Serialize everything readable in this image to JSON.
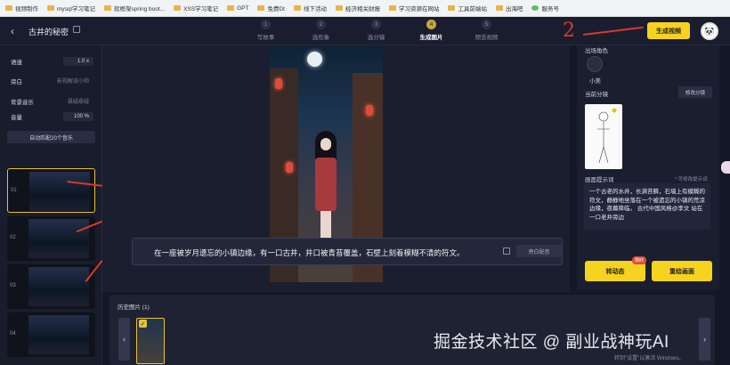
{
  "bookmarks": [
    "视频制作",
    "mysql学习笔记",
    "就框架spring boot...",
    "XSS学习笔记",
    "GPT",
    "免费Dt",
    "线下活动",
    "经济相关财报",
    "学习资源在网站",
    "工具前端站",
    "出海吧",
    "服务号"
  ],
  "header": {
    "back_icon": "arrow-left",
    "title": "古井的秘密",
    "generate_label": "生成视频",
    "avatar_text": "🐼"
  },
  "steps": [
    {
      "num": "1",
      "label": "写故事"
    },
    {
      "num": "2",
      "label": "选形象"
    },
    {
      "num": "3",
      "label": "选分镜"
    },
    {
      "num": "4",
      "label": "生成图片"
    },
    {
      "num": "5",
      "label": "预览视频"
    }
  ],
  "annotation_number": "2",
  "settings": {
    "speed_label": "语速",
    "speed_value": "1.0 x",
    "narration_label": "旁白",
    "narration_value": "影视解说小帅",
    "music_label": "背景音乐",
    "music_value": "悬疑悬疑",
    "volume_label": "音量",
    "volume_value": "100 %",
    "auto_label": "自动匹配20个音乐"
  },
  "scenes": [
    {
      "index": "01"
    },
    {
      "index": "02"
    },
    {
      "index": "03"
    },
    {
      "index": "04"
    }
  ],
  "caption": {
    "text": "在一座被岁月遗忘的小镇边缘，有一口古井，井口被青苔覆盖，石壁上刻着模糊不清的符文。",
    "dub_label": "旁白配音"
  },
  "history": {
    "title": "历史图片 (1)",
    "prev": "‹",
    "next": "›",
    "check": "✓"
  },
  "right": {
    "character_header": "出场角色",
    "character_btn": "",
    "character_name": "小美",
    "storyboard_label": "当前分镜",
    "storyboard_btn": "修改分镜",
    "prompt_label": "画面提示词",
    "prompt_hint": "* 可修改提示词",
    "prompt_text": "一个古老的水井，长满苔藓，石墙上有模糊的符文，静静地坐落在一个被遗忘的小镇的荒凉边缘，夜幕降临。 古代中国风格@李文 站在一口老井旁边",
    "btn_dynamic": "转动态",
    "btn_dynamic_badge": "限时",
    "btn_redraw": "重绘画面"
  },
  "watermark": "掘金技术社区 @ 副业战神玩AI",
  "activate": "转到\"设置\"以激活 Windows。"
}
